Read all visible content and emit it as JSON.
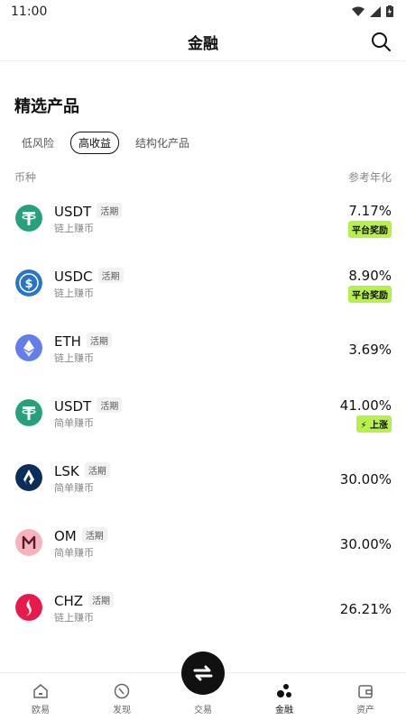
{
  "status_bar": {
    "time": "11:00"
  },
  "header": {
    "title": "金融"
  },
  "section": {
    "title": "精选产品"
  },
  "tabs": [
    {
      "label": "低风险",
      "active": false
    },
    {
      "label": "高收益",
      "active": true
    },
    {
      "label": "结构化产品",
      "active": false
    }
  ],
  "columns": {
    "left": "币种",
    "right": "参考年化"
  },
  "products": [
    {
      "coin": "USDT",
      "badge": "活期",
      "sub": "链上赚币",
      "rate": "7.17%",
      "tag": "平台奖励",
      "icon": "tether-icon",
      "color": "#26a17b"
    },
    {
      "coin": "USDC",
      "badge": "活期",
      "sub": "链上赚币",
      "rate": "8.90%",
      "tag": "平台奖励",
      "icon": "usdc-icon",
      "color": "#2775ca"
    },
    {
      "coin": "ETH",
      "badge": "活期",
      "sub": "链上赚币",
      "rate": "3.69%",
      "tag": "",
      "icon": "ethereum-icon",
      "color": "#627eea"
    },
    {
      "coin": "USDT",
      "badge": "活期",
      "sub": "简单赚币",
      "rate": "41.00%",
      "tag": "上涨",
      "icon": "tether-icon",
      "color": "#26a17b"
    },
    {
      "coin": "LSK",
      "badge": "活期",
      "sub": "简单赚币",
      "rate": "30.00%",
      "tag": "",
      "icon": "lisk-icon",
      "color": "#0c2c5a"
    },
    {
      "coin": "OM",
      "badge": "活期",
      "sub": "简单赚币",
      "rate": "30.00%",
      "tag": "",
      "icon": "mantra-icon",
      "color": "#f3a0b0"
    },
    {
      "coin": "CHZ",
      "badge": "活期",
      "sub": "链上赚币",
      "rate": "26.21%",
      "tag": "",
      "icon": "chiliz-icon",
      "color": "#e8194b"
    }
  ],
  "bottom_nav": [
    {
      "label": "欧易",
      "icon": "home-icon",
      "active": false
    },
    {
      "label": "发现",
      "icon": "discover-icon",
      "active": false
    },
    {
      "label": "交易",
      "icon": "trade-icon",
      "active": false
    },
    {
      "label": "金融",
      "icon": "finance-icon",
      "active": true
    },
    {
      "label": "资产",
      "icon": "wallet-icon",
      "active": false
    }
  ],
  "colors": {
    "accent": "#b7f04c",
    "text": "#111111",
    "muted": "#888888"
  }
}
